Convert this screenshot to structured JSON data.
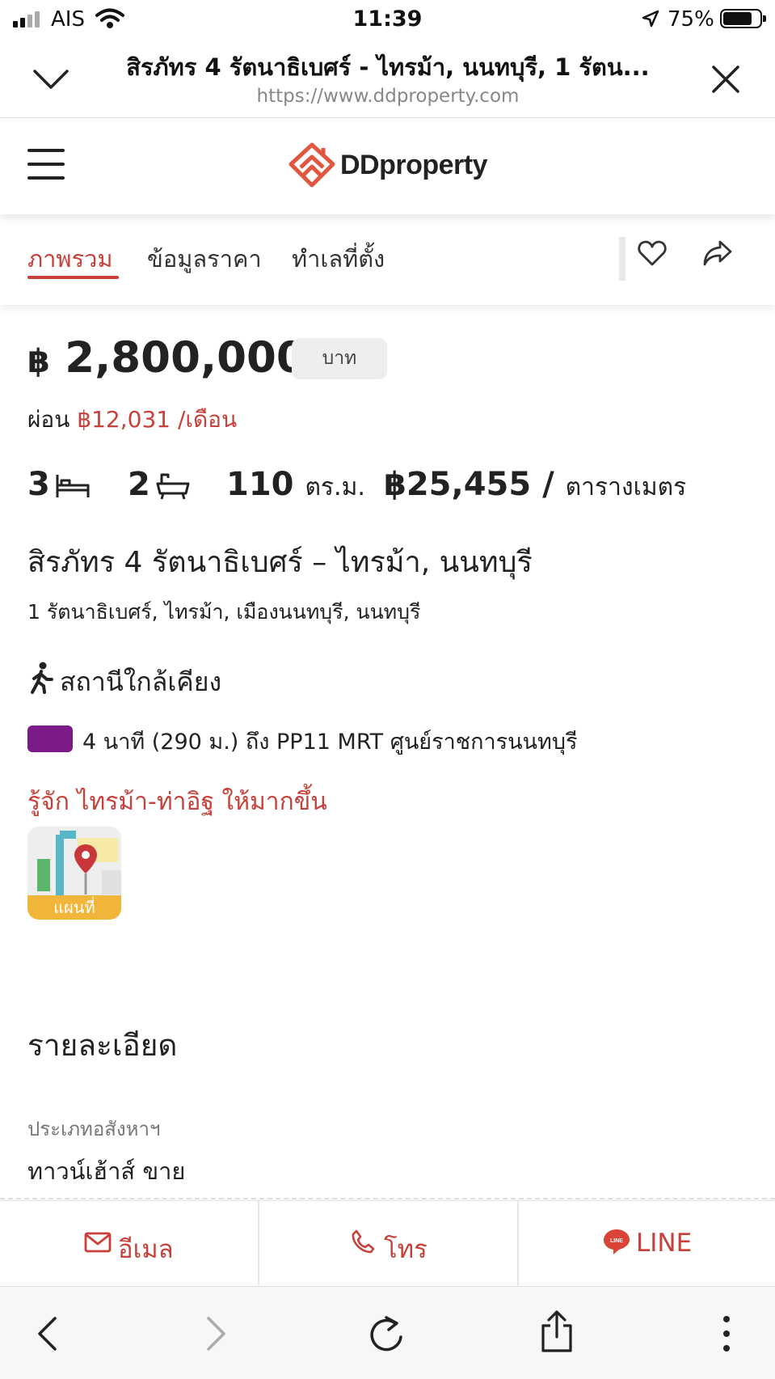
{
  "status_bar": {
    "carrier": "AIS",
    "time": "11:39",
    "battery": "75%"
  },
  "browser": {
    "page_title": "สิรภัทร 4 รัตนาธิเบศร์ - ไทรม้า, นนทบุรี, 1 รัตน...",
    "url": "https://www.ddproperty.com",
    "collapse_icon": "chevron-down-icon",
    "close_icon": "close-icon"
  },
  "site": {
    "brand": "DDproperty"
  },
  "tabs": [
    {
      "label": "ภาพรวม",
      "active": true
    },
    {
      "label": "ข้อมูลราคา",
      "active": false
    },
    {
      "label": "ทำเลที่ตั้ง",
      "active": false
    }
  ],
  "listing": {
    "currency_symbol": "฿",
    "price": "2,800,000",
    "price_unit": "บาท",
    "installment_prefix": "ผ่อน",
    "installment": "฿12,031 /เดือน",
    "bedrooms": "3",
    "bathrooms": "2",
    "area_value": "110",
    "area_unit": "ตร.ม.",
    "price_per_area": "฿25,455 /",
    "price_per_area_unit": "ตารางเมตร",
    "title": "สิรภัทร 4 รัตนาธิเบศร์ – ไทรม้า, นนทบุรี",
    "address": "1 รัตนาธิเบศร์, ไทรม้า, เมืองนนทบุรี, นนทบุรี"
  },
  "nearby": {
    "heading": "สถานีใกล้เคียง",
    "station_text": "4 นาที (290 ม.) ถึง PP11 MRT ศูนย์ราชการนนทบุรี",
    "line_color": "#7d1a8a",
    "area_link": "รู้จัก ไทรม้า-ท่าอิฐ ให้มากขึ้น",
    "map_label": "แผนที่"
  },
  "details": {
    "heading": "รายละเอียด",
    "property_type_label": "ประเภทอสังหาฯ",
    "property_type_value": "ทาวน์เฮ้าส์ ขาย"
  },
  "contact": {
    "email": "อีเมล",
    "call": "โทร",
    "line": "LINE",
    "line_badge": "LINE"
  },
  "colors": {
    "accent": "#c8403a",
    "station": "#7d1a8a"
  }
}
